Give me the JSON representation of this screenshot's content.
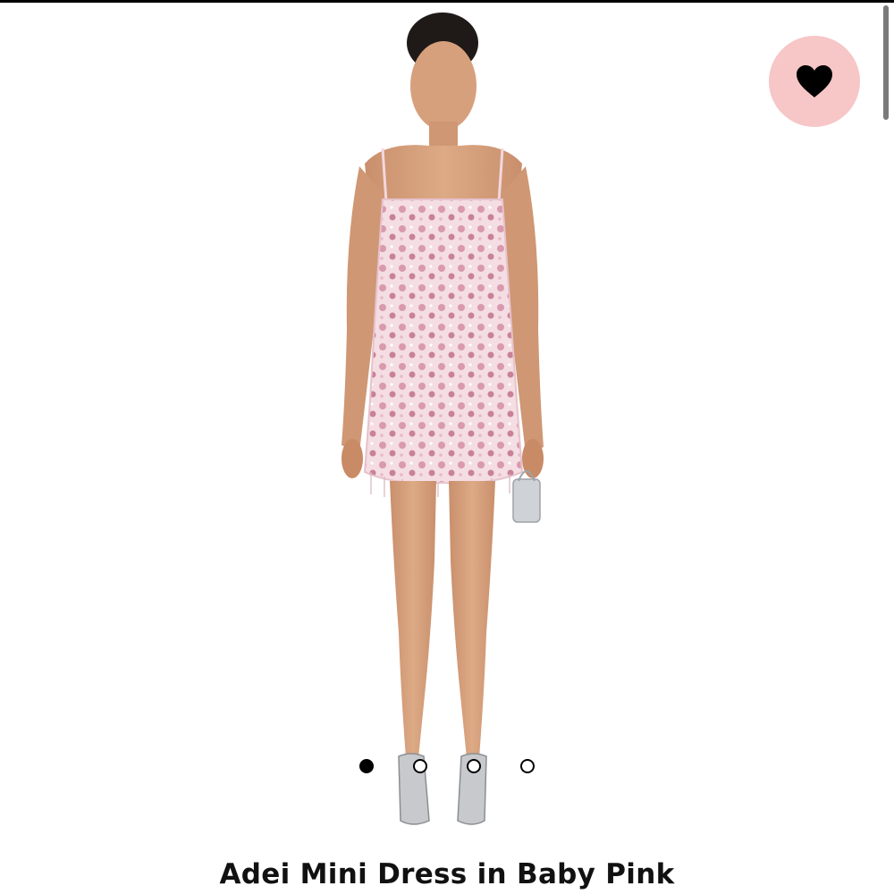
{
  "product": {
    "title": "Adei Mini Dress in Baby Pink"
  },
  "gallery": {
    "image_icon": "model-in-pink-sequin-mini-dress",
    "image_count": 4,
    "active_index": 0
  },
  "favorite": {
    "icon": "heart-icon",
    "background_color": "#f7c6c7",
    "icon_color": "#000000"
  },
  "colors": {
    "accent_pink": "#f7c6c7",
    "dress_pink": "#f2d3d9"
  }
}
